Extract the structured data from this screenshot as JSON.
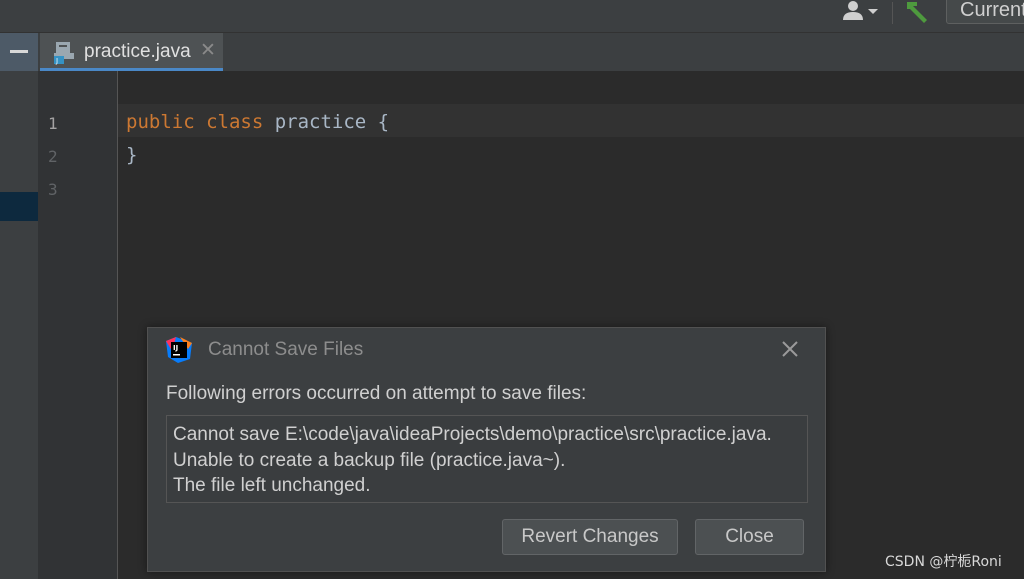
{
  "toolbar": {
    "run_config_label": "Current",
    "user_icon": "user-icon",
    "build_icon": "hammer-icon"
  },
  "tabs": [
    {
      "label": "practice.java",
      "icon": "java-file-icon",
      "close": "✕"
    }
  ],
  "editor": {
    "line_numbers": [
      "1",
      "2",
      "3"
    ],
    "lines": [
      {
        "keyword1": "public",
        "keyword2": "class",
        "rest": " practice {"
      },
      {
        "text": "}"
      },
      {
        "text": ""
      }
    ]
  },
  "dialog": {
    "title": "Cannot Save Files",
    "message": "Following errors occurred on attempt to save files:",
    "details": [
      "Cannot save E:\\code\\java\\ideaProjects\\demo\\practice\\src\\practice.java.",
      "Unable to create a backup file (practice.java~).",
      "The file left unchanged."
    ],
    "buttons": {
      "revert": "Revert Changes",
      "close": "Close"
    }
  },
  "watermark": "CSDN @柠栀Roni",
  "colors": {
    "background": "#2b2b2b",
    "keyword": "#cc7832",
    "tab_underline": "#4a88c7",
    "build_icon": "#4e9a3e"
  }
}
